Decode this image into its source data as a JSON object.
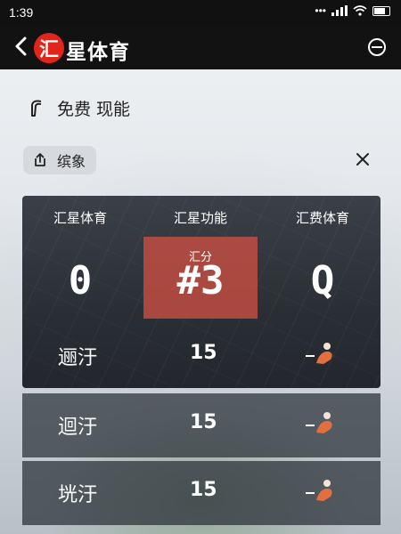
{
  "status_bar": {
    "time": "1:39"
  },
  "header": {
    "logo_char": "汇",
    "title": "星体育"
  },
  "feature": {
    "label": "免费 现能"
  },
  "tag": {
    "label": "缤象"
  },
  "scoreboard": {
    "col1_label": "汇星体育",
    "col2_label": "汇星功能",
    "col3_label": "汇费体育",
    "center_sub_label": "汇分",
    "left_score": "0",
    "center_value": "#3",
    "right_score": "Q"
  },
  "stats": [
    {
      "name": "逦汙",
      "value": "15"
    },
    {
      "name": "迴汙",
      "value": "15"
    },
    {
      "name": "垙汙",
      "value": "15"
    }
  ],
  "colors": {
    "accent": "#e1251b",
    "highlight": "#cd5042",
    "header_bg": "#121212"
  }
}
